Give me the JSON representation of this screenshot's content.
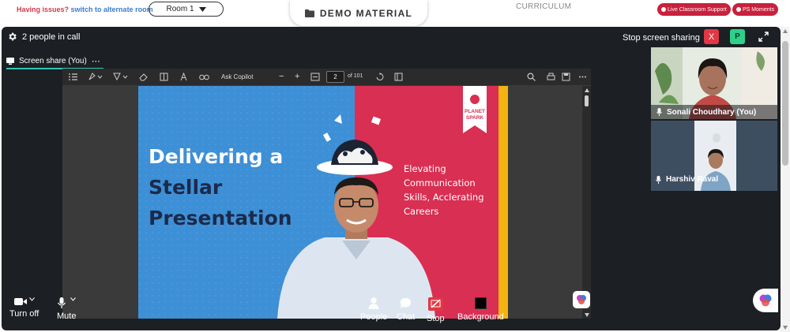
{
  "topbar": {
    "issues_text": "Having issues?",
    "alternate_link": "switch to alternate room",
    "room_value": "Room 1",
    "demo_material": "DEMO MATERIAL",
    "curriculum": "CURRICULUM",
    "live_support": "Live Classroom Support",
    "ps_moments": "PS Moments"
  },
  "call": {
    "people_count": "2 people in call",
    "stop_sharing": "Stop screen sharing",
    "stop_icon": "X",
    "participant_badge": "P",
    "tab_label": "Screen share (You)",
    "tab_more": "⋯"
  },
  "pdf": {
    "ask_copilot": "Ask Copilot",
    "zoom_out": "−",
    "zoom_in": "+",
    "page_value": "2",
    "page_of": "of 101",
    "slide": {
      "title_line1": "Delivering a",
      "title_line2": "Stellar",
      "title_line3": "Presentation",
      "subtitle_line1": "Elevating",
      "subtitle_line2": "Communication",
      "subtitle_line3": "Skills, Acclerating",
      "subtitle_line4": "Careers",
      "logo_line1": "PLANET",
      "logo_line2": "SPARK"
    }
  },
  "participants": [
    {
      "name": "Sonali Choudhary (You)"
    },
    {
      "name": "Harshiv Raval"
    }
  ],
  "controls": {
    "camera": "Turn off",
    "mic": "Mute",
    "people": "People",
    "chat": "Chat",
    "stop": "Stop",
    "background": "Background"
  },
  "colors": {
    "slide_blue": "#3d8fd6",
    "slide_red": "#d92f52",
    "slide_yellow": "#f5b311",
    "brand_red": "#c8213d",
    "stop_red": "#e23744",
    "accent_green": "#2fd08a",
    "tab_teal": "#2fc6b4"
  }
}
